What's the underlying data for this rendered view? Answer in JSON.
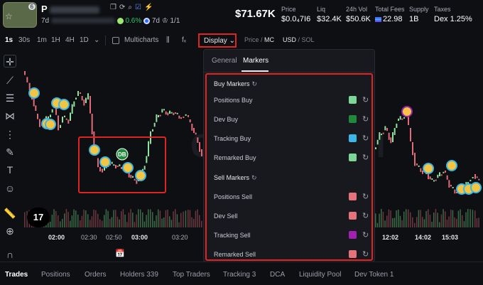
{
  "header": {
    "token_name": "P",
    "avatar_badge": "6",
    "age": "7d",
    "holder_pct": "0.6%",
    "holder_age": "7d",
    "ratio": "1/1",
    "price_big": "$71.67K",
    "stats": [
      {
        "label": "Price",
        "value": "$0.0₄7I6"
      },
      {
        "label": "Liq",
        "value": "$32.4K"
      },
      {
        "label": "24h Vol",
        "value": "$50.6K"
      },
      {
        "label": "Total Fees",
        "value": "22.98"
      },
      {
        "label": "Supply",
        "value": "1B"
      },
      {
        "label": "Taxes",
        "value": "Dex 1.25%"
      }
    ]
  },
  "toolbar": {
    "timeframes": [
      "1s",
      "30s",
      "1m",
      "1H",
      "4H",
      "1D"
    ],
    "multicharts": "Multicharts",
    "display": "Display",
    "price": "Price",
    "mc": "MC",
    "usd": "USD",
    "sol": "SOL",
    "fx": "fₓ"
  },
  "time_axis": [
    "02:00",
    "02:30",
    "02:50",
    "03:00",
    "03:20",
    "12:02",
    "14:02",
    "15:03"
  ],
  "panel": {
    "tabs": [
      "General",
      "Markers"
    ],
    "buy_title": "Buy Markers",
    "buy_rows": [
      {
        "label": "Positions Buy",
        "color": "#7dd695"
      },
      {
        "label": "Dev Buy",
        "color": "#1f8a3c"
      },
      {
        "label": "Tracking Buy",
        "color": "#3bb6e6"
      },
      {
        "label": "Remarked Buy",
        "color": "#7dd695"
      }
    ],
    "sell_title": "Sell Markers",
    "sell_rows": [
      {
        "label": "Positions Sell",
        "color": "#e5737c"
      },
      {
        "label": "Dev Sell",
        "color": "#e5737c"
      },
      {
        "label": "Tracking Sell",
        "color": "#a020b0"
      },
      {
        "label": "Remarked Sell",
        "color": "#e5737c"
      }
    ]
  },
  "chart": {
    "dev_marker": "DB",
    "tv_logo": "17",
    "up_color": "#8fe39f",
    "down_color": "#e56a78"
  },
  "bottom_tabs": [
    "Trades",
    "Positions",
    "Orders",
    "Holders 339",
    "Top Traders",
    "Tracking 3",
    "DCA",
    "Liquidity Pool",
    "Dev Token 1"
  ]
}
